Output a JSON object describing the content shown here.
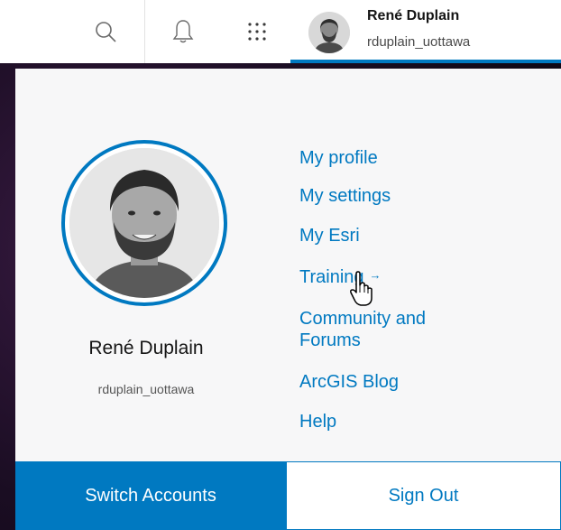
{
  "header": {
    "icons": [
      "search-icon",
      "bell-icon",
      "apps-grid-icon"
    ],
    "user_name": "René Duplain",
    "username": "rduplain_uottawa"
  },
  "panel": {
    "user_name": "René Duplain",
    "username": "rduplain_uottawa",
    "links": [
      {
        "label": "My profile"
      },
      {
        "label": "My settings"
      },
      {
        "label": "My Esri"
      },
      {
        "label": "Training",
        "arrow": "→"
      },
      {
        "label_line1": "Community and",
        "label_line2": "Forums"
      },
      {
        "label": "ArcGIS Blog"
      },
      {
        "label": "Help"
      }
    ],
    "switch_label": "Switch Accounts",
    "signout_label": "Sign Out"
  },
  "colors": {
    "accent": "#0079c1",
    "panel_bg": "#f7f7f8",
    "text_dark": "#151515"
  }
}
